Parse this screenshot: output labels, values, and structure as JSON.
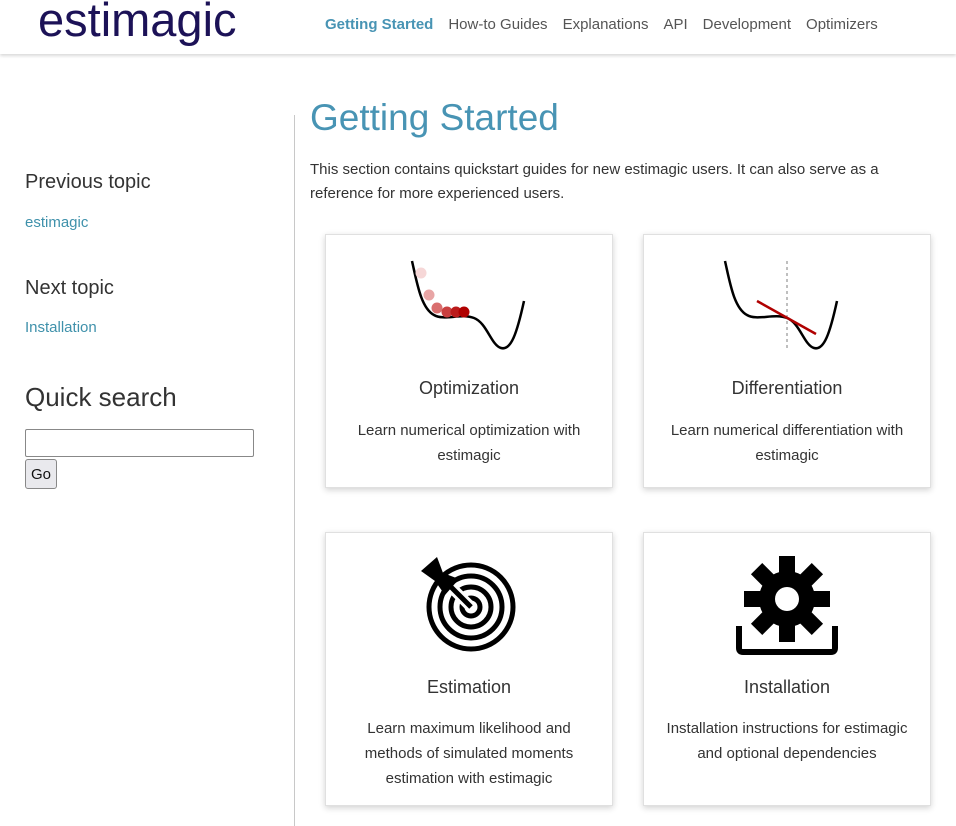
{
  "navbar": {
    "logo": "estimagic",
    "links": [
      "Getting Started",
      "How-to Guides",
      "Explanations",
      "API",
      "Development",
      "Optimizers"
    ],
    "active": "Getting Started"
  },
  "sidebar": {
    "previous_heading": "Previous topic",
    "previous_link": "estimagic",
    "next_heading": "Next topic",
    "next_link": "Installation",
    "search_heading": "Quick search",
    "search_value": "",
    "go_label": "Go"
  },
  "main": {
    "title": "Getting Started",
    "intro": "This section contains quickstart guides for new estimagic users. It can also serve as a reference for more experienced users.",
    "cards": [
      {
        "title": "Optimization",
        "text": "Learn numerical optimization with estimagic",
        "icon": "optimization-icon"
      },
      {
        "title": "Differentiation",
        "text": "Learn numerical differentiation with estimagic",
        "icon": "differentiation-icon"
      },
      {
        "title": "Estimation",
        "text": "Learn maximum likelihood and methods of simulated moments estimation with estimagic",
        "icon": "target-icon"
      },
      {
        "title": "Installation",
        "text": "Installation instructions for estimagic and optional dependencies",
        "icon": "gear-install-icon"
      }
    ]
  },
  "colors": {
    "accent": "#4894b4",
    "logo": "#1c1257",
    "marker_red": "#b00000"
  }
}
